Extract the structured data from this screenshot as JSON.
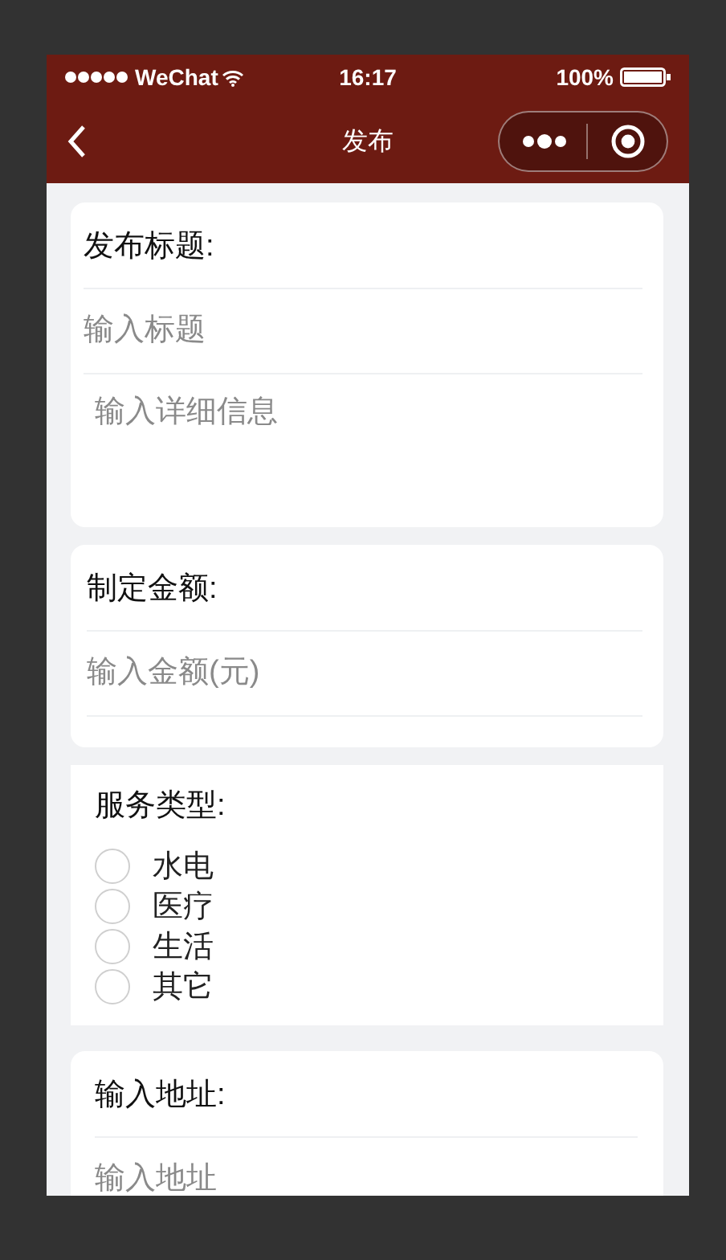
{
  "status_bar": {
    "carrier": "WeChat",
    "time": "16:17",
    "battery": "100%"
  },
  "nav": {
    "title": "发布"
  },
  "sections": [
    {
      "kind": "title",
      "label": "发布标题:",
      "title_placeholder": "输入标题",
      "detail_placeholder": "输入详细信息"
    },
    {
      "kind": "input",
      "label": "制定金额:",
      "placeholder": "输入金额(元)"
    },
    {
      "kind": "radio",
      "label": "服务类型:",
      "options": [
        {
          "label": "水电",
          "selected": false
        },
        {
          "label": "医疗",
          "selected": false
        },
        {
          "label": "生活",
          "selected": false
        },
        {
          "label": "其它",
          "selected": false
        }
      ]
    },
    {
      "kind": "input",
      "label": "输入地址:",
      "placeholder": "输入地址"
    }
  ]
}
